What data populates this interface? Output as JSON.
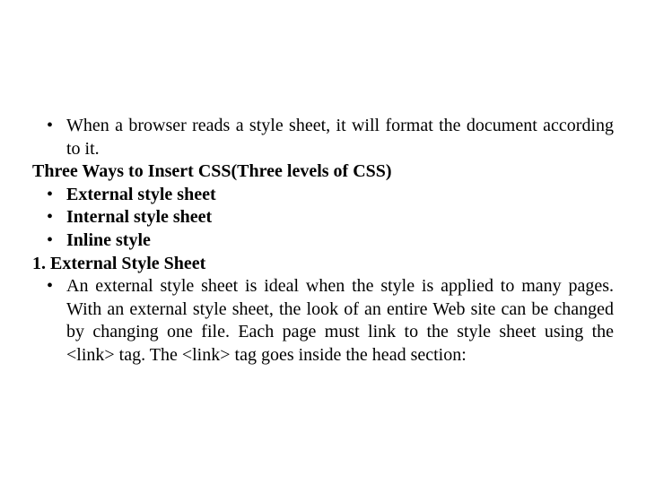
{
  "bullet1": "When a browser reads a style sheet, it will format the document according to it.",
  "heading1": "Three Ways to Insert CSS(Three levels of CSS)",
  "list1_item1": "External style sheet",
  "list1_item2": "Internal style sheet",
  "list1_item3": "Inline style",
  "heading2": "1. External Style Sheet",
  "para1": "An external style sheet is ideal when the style is applied to many pages. With an external style sheet, the look of an entire Web site can be changed by changing one file. Each page must link to the style sheet using the <link> tag. The <link> tag goes inside the head section:"
}
